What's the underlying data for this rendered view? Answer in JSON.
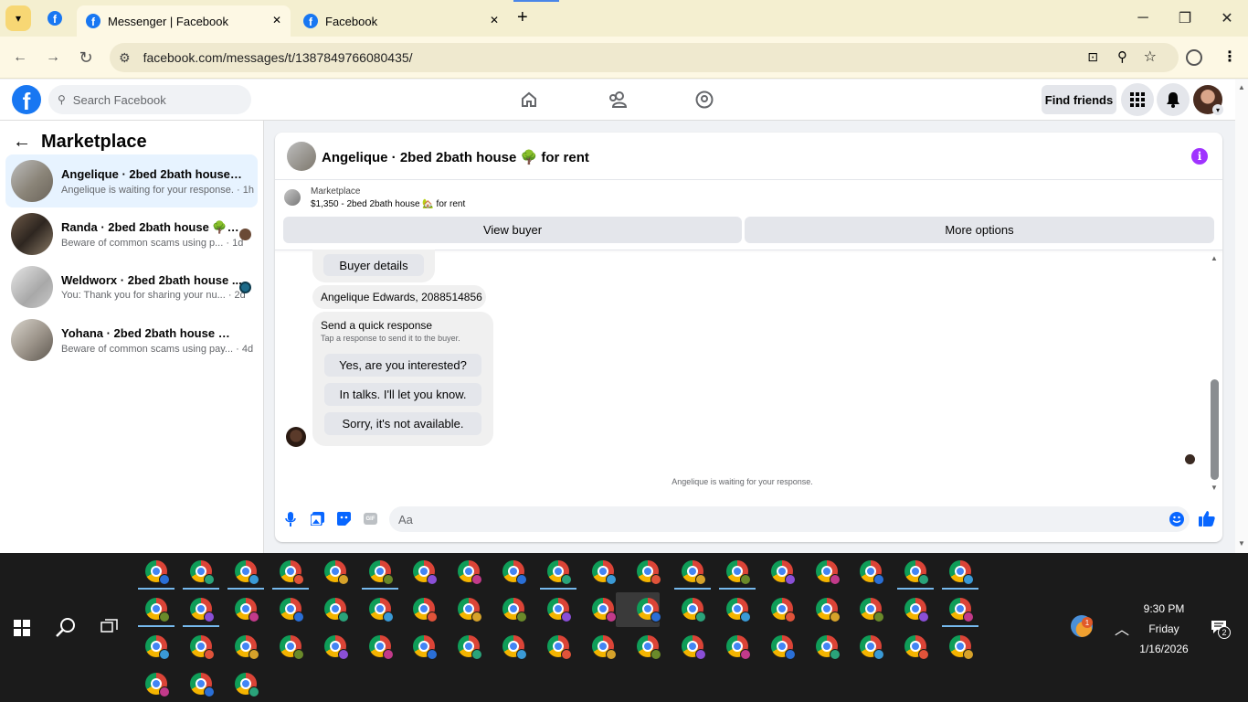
{
  "browser": {
    "tabs": [
      {
        "label": "Messenger | Facebook",
        "active": true
      },
      {
        "label": "Facebook",
        "active": false
      }
    ],
    "url": "facebook.com/messages/t/1387849766080435/",
    "new_tab": "+",
    "close_glyph": "✕"
  },
  "facebook": {
    "logo": "f",
    "search_placeholder": "Search Facebook",
    "find_friends": "Find friends"
  },
  "sidebar": {
    "title": "Marketplace",
    "conversations": [
      {
        "title": "Angelique · 2bed 2bath house 🌳 f...",
        "preview": "Angelique is waiting for your response. · 1h"
      },
      {
        "title": "Randa · 2bed 2bath house 🌳 fo...",
        "preview": "Beware of common scams using p... · 1d"
      },
      {
        "title": "Weldworx · 2bed 2bath house ...",
        "preview": "You: Thank you for sharing your nu... · 2d"
      },
      {
        "title": "Yohana · 2bed 2bath house 🌳 for ...",
        "preview": "Beware of common scams using pay... · 4d"
      }
    ]
  },
  "chat": {
    "header_title": "Angelique · 2bed 2bath house 🌳 for rent",
    "listing_label": "Marketplace",
    "listing_detail": "$1,350 - 2bed 2bath house 🏡 for rent",
    "view_buyer": "View buyer",
    "more_options": "More options",
    "buyer_details": "Buyer details",
    "buyer_contact": "Angelique Edwards, 2088514856",
    "quick_title": "Send a quick response",
    "quick_subtitle": "Tap a response to send it to the buyer.",
    "quick_responses": [
      "Yes, are you interested?",
      "In talks. I'll let you know.",
      "Sorry, it's not available."
    ],
    "status": "Angelique is waiting for your response.",
    "composer_placeholder": "Aa"
  },
  "taskbar": {
    "time": "9:30 PM",
    "day": "Friday",
    "date": "1/16/2026",
    "weather_badge": "1",
    "notification_count": "2"
  },
  "colors": {
    "brand": "#1877f2",
    "info_icon": "#a033ff"
  }
}
